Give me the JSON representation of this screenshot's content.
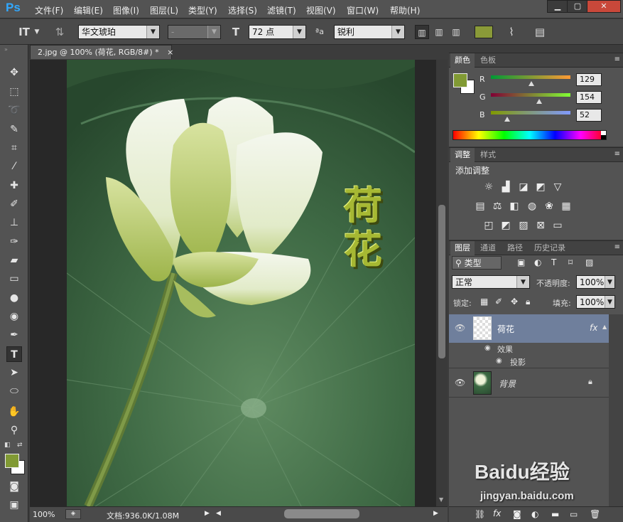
{
  "app": {
    "logo": "Ps"
  },
  "menu": [
    "文件(F)",
    "编辑(E)",
    "图像(I)",
    "图层(L)",
    "类型(Y)",
    "选择(S)",
    "滤镜(T)",
    "视图(V)",
    "窗口(W)",
    "帮助(H)"
  ],
  "window_controls": {
    "minimize": "▁",
    "restore": "▢",
    "close": "✕"
  },
  "options": {
    "font_family": "华文琥珀",
    "font_style": "-",
    "font_size": "72 点",
    "aa_icon_label": "ªa",
    "antialias": "锐利",
    "text_color": "#8a9a38"
  },
  "document": {
    "tab_title": "2.jpg @ 100% (荷花, RGB/8#) *",
    "tab_close": "×",
    "overlay_text": [
      "荷",
      "花"
    ],
    "zoom": "100%",
    "doc_size": "文档:936.0K/1.08M"
  },
  "color_panel": {
    "tabs": [
      "颜色",
      "色板"
    ],
    "r_label": "R",
    "g_label": "G",
    "b_label": "B",
    "r": "129",
    "g": "154",
    "b": "52",
    "foreground": "#819a34",
    "background": "#ffffff"
  },
  "adjust_panel": {
    "tabs": [
      "调整",
      "样式"
    ],
    "title": "添加调整"
  },
  "layers_panel": {
    "tabs": [
      "图层",
      "通道",
      "路径",
      "历史记录"
    ],
    "filter_kind": "类型",
    "blend_mode": "正常",
    "opacity_label": "不透明度:",
    "opacity": "100%",
    "lock_label": "锁定:",
    "fill_label": "填充:",
    "fill": "100%",
    "layers": [
      {
        "name": "荷花",
        "fx": "fx",
        "effects_label": "效果",
        "effect": "投影"
      },
      {
        "name": "背景"
      }
    ]
  },
  "watermark": {
    "brand": "Baidu经验",
    "url": "jingyan.baidu.com"
  }
}
